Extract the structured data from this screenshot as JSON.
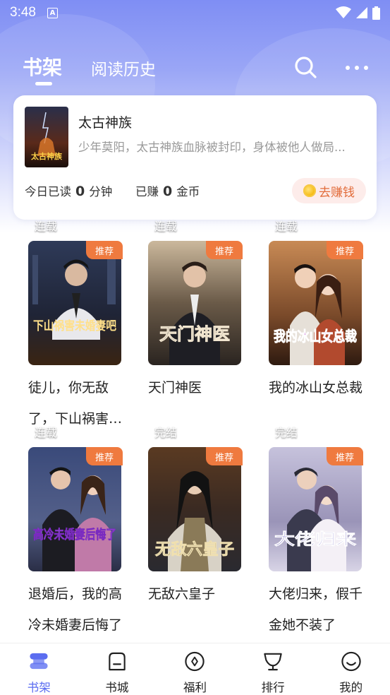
{
  "status_bar": {
    "time": "3:48",
    "indicator": "A"
  },
  "header": {
    "tabs": [
      "书架",
      "阅读历史"
    ],
    "active_tab": "书架",
    "search_icon": "search-icon",
    "more_icon": "more-horizontal-icon"
  },
  "reading_card": {
    "book_title": "太古神族",
    "description": "少年莫阳，太古神族血脉被封印，身体被他人做局...",
    "today_read_prefix": "今日已读",
    "today_read_value": "0",
    "today_read_unit": "分钟",
    "earned_prefix": "已赚",
    "earned_value": "0",
    "earned_unit": "金币",
    "earn_button": "去赚钱",
    "cover_text": "太古神族"
  },
  "books": [
    {
      "title": "徒儿，你无敌了，下山祸害未婚妻吧",
      "badge": "推荐",
      "status": "连载",
      "cover_text": "下山祸害未婚妻吧"
    },
    {
      "title": "天门神医",
      "badge": "推荐",
      "status": "连载",
      "cover_text": "天门神医"
    },
    {
      "title": "我的冰山女总裁",
      "badge": "推荐",
      "status": "连载",
      "cover_text": "我的冰山女总裁"
    },
    {
      "title": "退婚后，我的高冷未婚妻后悔了",
      "badge": "推荐",
      "status": "连载",
      "cover_text": "高冷未婚妻后悔了"
    },
    {
      "title": "无敌六皇子",
      "badge": "推荐",
      "status": "完结",
      "cover_text": "无敌六皇子"
    },
    {
      "title": "大佬归来，假千金她不装了",
      "badge": "推荐",
      "status": "完结",
      "cover_text": "大佬归来"
    }
  ],
  "bottom_nav": [
    {
      "label": "书架",
      "icon": "bookshelf-icon",
      "active": true
    },
    {
      "label": "书城",
      "icon": "bookstore-icon",
      "active": false
    },
    {
      "label": "福利",
      "icon": "welfare-icon",
      "active": false
    },
    {
      "label": "排行",
      "icon": "trophy-icon",
      "active": false
    },
    {
      "label": "我的",
      "icon": "profile-icon",
      "active": false
    }
  ],
  "colors": {
    "accent": "#5b6df0",
    "badge": "#ef7a3f",
    "earn_text": "#e26c3a",
    "earn_bg": "#fdecea"
  }
}
